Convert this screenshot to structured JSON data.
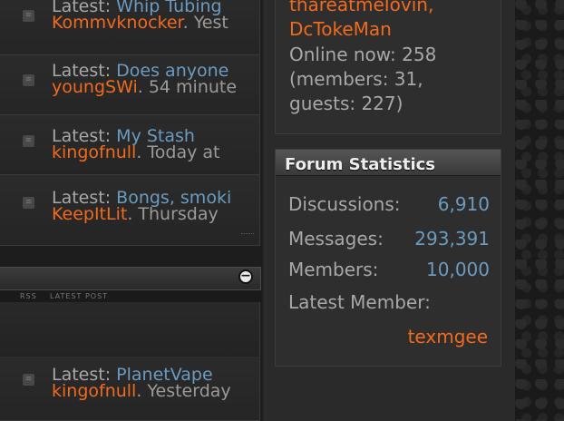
{
  "forum_rows_top": [
    {
      "latest_label": "Latest:",
      "thread": "Whip Tubing",
      "user": "Kommvknocker",
      "time": ". Yest"
    },
    {
      "latest_label": "Latest:",
      "thread": "Does anyone",
      "user": "youngSWi",
      "time": ". 54 minute"
    },
    {
      "latest_label": "Latest:",
      "thread": "My Stash",
      "user": "kingofnull",
      "time": ". Today at"
    },
    {
      "latest_label": "Latest:",
      "thread": "Bongs, smoki",
      "user": "KeepItLit",
      "time": ". Thursday"
    }
  ],
  "section": {
    "subheader_rss": "RSS",
    "subheader_latest": "LATEST POST",
    "collapse_symbol": "−"
  },
  "forum_rows_bottom": [
    {
      "latest_label": "Latest:",
      "thread": "PlanetVape",
      "user": "kingofnull",
      "time": ". Yesterday"
    }
  ],
  "online": {
    "names": [
      "thareatmeIovin,",
      "DcTokeMan"
    ],
    "online_now": "Online now: 258",
    "breakdown_line1": "(members: 31,",
    "breakdown_line2": "guests: 227)"
  },
  "stats": {
    "title": "Forum Statistics",
    "discussions_label": "Discussions:",
    "discussions_value": "6,910",
    "messages_label": "Messages:",
    "messages_value": "293,391",
    "members_label": "Members:",
    "members_value": "10,000",
    "latest_member_label": "Latest Member:",
    "latest_member": "texmgee"
  },
  "colors": {
    "link_blue": "#6b9bbf",
    "user_orange": "#f26a1b",
    "text_gray": "#a8a8a8"
  },
  "icons": [
    "rss-icon",
    "collapse-icon"
  ]
}
